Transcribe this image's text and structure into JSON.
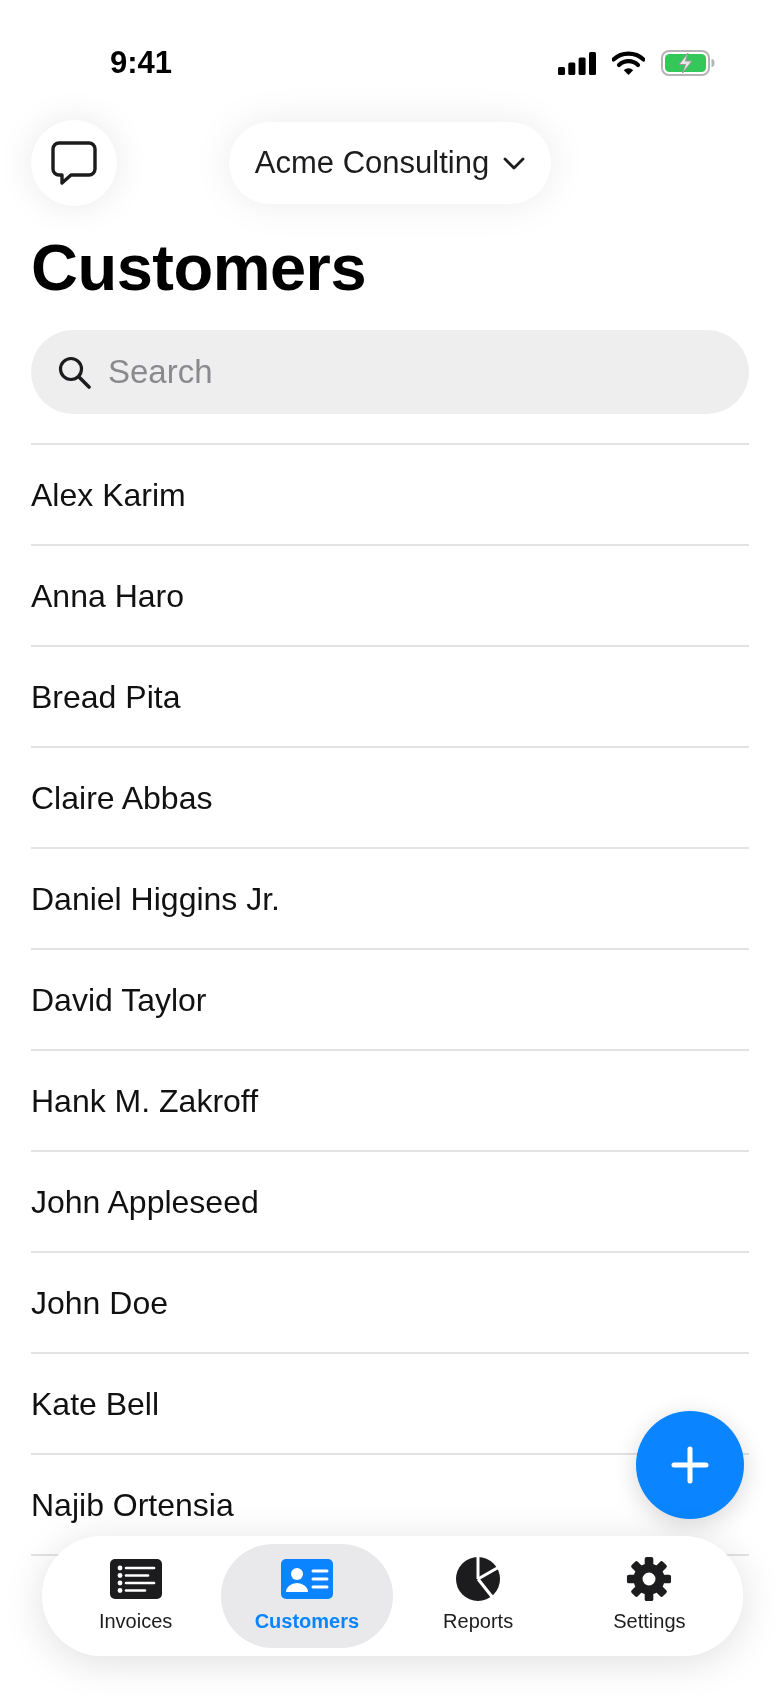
{
  "status_bar": {
    "time": "9:41"
  },
  "header": {
    "company": "Acme Consulting"
  },
  "title": "Customers",
  "search": {
    "placeholder": "Search"
  },
  "customers": [
    "Alex Karim",
    "Anna Haro",
    "Bread Pita",
    "Claire Abbas",
    "Daniel Higgins Jr.",
    "David Taylor",
    "Hank M. Zakroff",
    "John Appleseed",
    "John Doe",
    "Kate Bell",
    "Najib Ortensia"
  ],
  "tabs": [
    {
      "kind": "list",
      "label": "Invoices",
      "selected": false
    },
    {
      "kind": "contact-card",
      "label": "Customers",
      "selected": true
    },
    {
      "kind": "pie",
      "label": "Reports",
      "selected": false
    },
    {
      "kind": "gear",
      "label": "Settings",
      "selected": false
    }
  ]
}
